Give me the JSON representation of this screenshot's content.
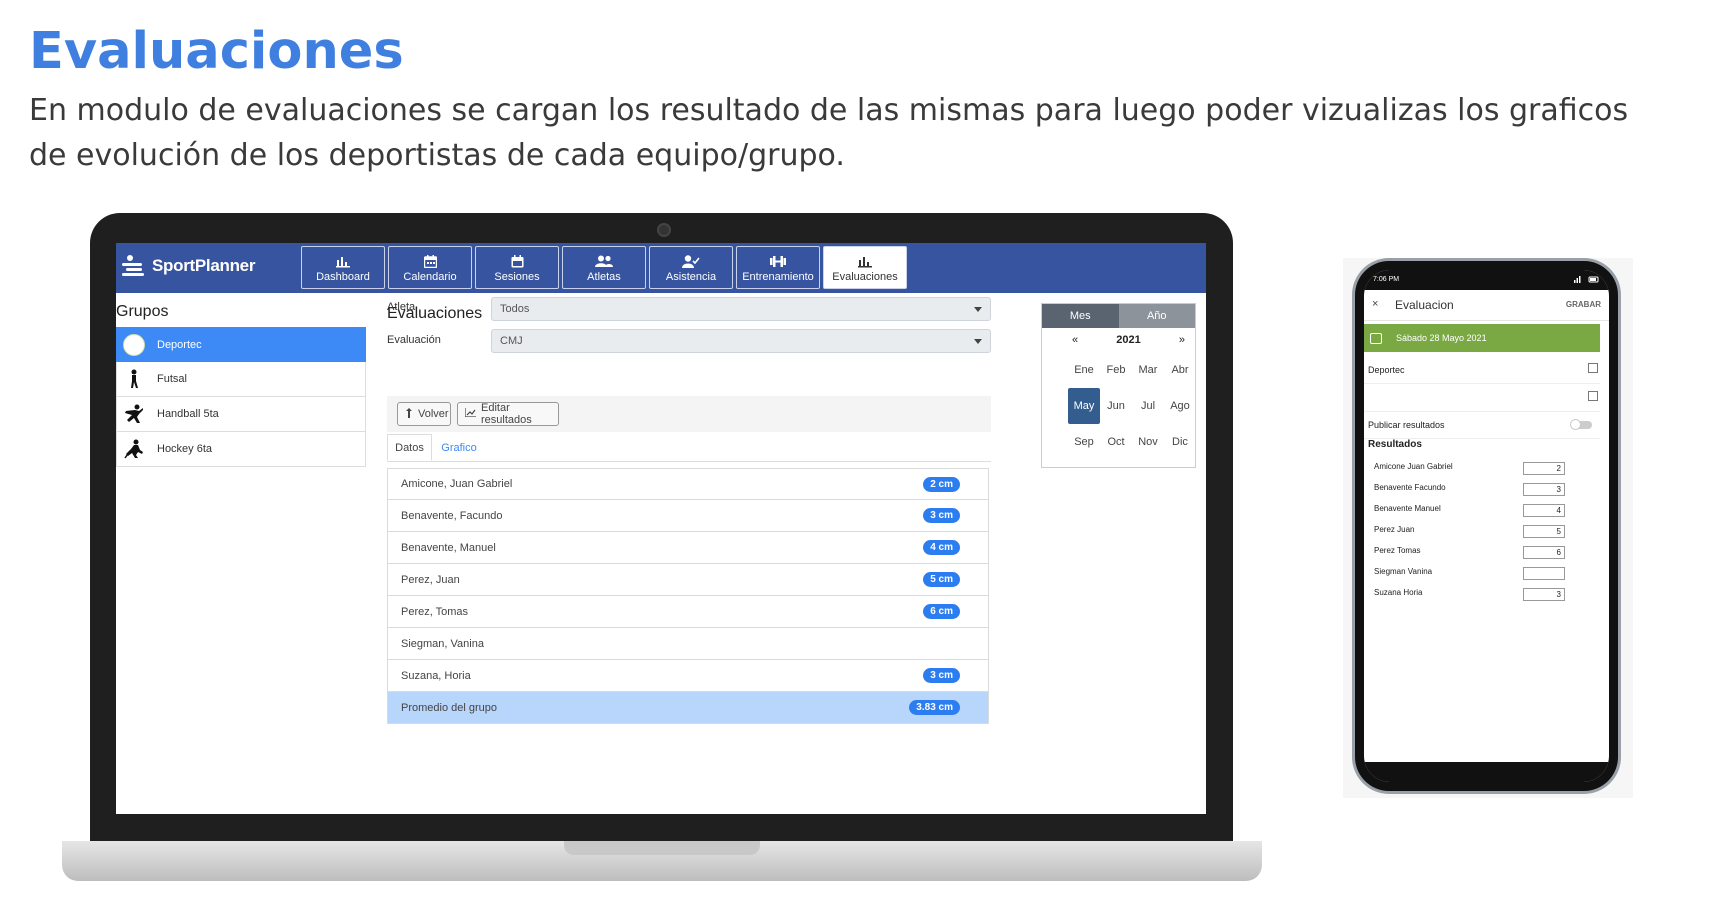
{
  "slide": {
    "title": "Evaluaciones",
    "description": "En modulo de evaluaciones se cargan los resultado de las mismas para luego poder vizualizas los graficos de evolución de los deportistas de cada equipo/grupo."
  },
  "app": {
    "brand": "SportPlanner",
    "nav": [
      {
        "label": "Dashboard",
        "icon": "bar-chart-icon"
      },
      {
        "label": "Calendario",
        "icon": "calendar-icon"
      },
      {
        "label": "Sesiones",
        "icon": "calendar-check-icon"
      },
      {
        "label": "Atletas",
        "icon": "users-icon"
      },
      {
        "label": "Asistencia",
        "icon": "user-check-icon"
      },
      {
        "label": "Entrenamiento",
        "icon": "dumbbell-icon"
      },
      {
        "label": "Evaluaciones",
        "icon": "chart-icon",
        "active": true
      }
    ],
    "groups": {
      "title": "Grupos",
      "items": [
        {
          "label": "Deportec",
          "icon": "deportec-logo",
          "active": true
        },
        {
          "label": "Futsal",
          "icon": "futsal-player-icon"
        },
        {
          "label": "Handball 5ta",
          "icon": "handball-player-icon"
        },
        {
          "label": "Hockey 6ta",
          "icon": "hockey-player-icon"
        }
      ]
    },
    "main": {
      "title": "Evaluaciones",
      "athlete_label": "Atleta",
      "athlete_value": "Todos",
      "evaluation_label": "Evaluación",
      "evaluation_value": "CMJ",
      "back_button": "Volver",
      "edit_button": "Editar resultados",
      "tabs": [
        "Datos",
        "Grafico"
      ],
      "results": [
        {
          "name": "Amicone, Juan Gabriel",
          "value": "2 cm"
        },
        {
          "name": "Benavente, Facundo",
          "value": "3 cm"
        },
        {
          "name": "Benavente, Manuel",
          "value": "4 cm"
        },
        {
          "name": "Perez, Juan",
          "value": "5 cm"
        },
        {
          "name": "Perez, Tomas",
          "value": "6 cm"
        },
        {
          "name": "Siegman, Vanina",
          "value": ""
        },
        {
          "name": "Suzana, Horia",
          "value": "3 cm"
        }
      ],
      "average": {
        "name": "Promedio del grupo",
        "value": "3.83 cm"
      }
    },
    "calendar": {
      "toggle": [
        "Mes",
        "Año"
      ],
      "prev": "«",
      "next": "»",
      "year": "2021",
      "months": [
        "Ene",
        "Feb",
        "Mar",
        "Abr",
        "May",
        "Jun",
        "Jul",
        "Ago",
        "Sep",
        "Oct",
        "Nov",
        "Dic"
      ],
      "selected_month": "May"
    }
  },
  "phone": {
    "status_time": "7:06 PM",
    "title": "Evaluacion",
    "close": "×",
    "save": "GRABAR",
    "date": "Sábado 28 Mayo 2021",
    "group": "Deportec",
    "publish_label": "Publicar resultados",
    "results_title": "Resultados",
    "results": [
      {
        "name": "Amicone Juan Gabriel",
        "value": "2"
      },
      {
        "name": "Benavente Facundo",
        "value": "3"
      },
      {
        "name": "Benavente Manuel",
        "value": "4"
      },
      {
        "name": "Perez Juan",
        "value": "5"
      },
      {
        "name": "Perez Tomas",
        "value": "6"
      },
      {
        "name": "Siegman Vanina",
        "value": ""
      },
      {
        "name": "Suzana Horia",
        "value": "3"
      }
    ]
  },
  "colors": {
    "title_blue": "#3f7fe0",
    "navbar": "#3654a0",
    "active_group": "#3d8af7",
    "pill": "#2c7ef0",
    "average_row": "#b8d6fb",
    "calendar_selected": "#335d8e",
    "phone_date_bar": "#7aa843"
  }
}
